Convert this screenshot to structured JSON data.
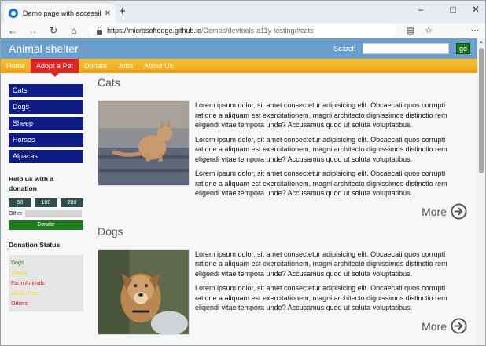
{
  "browser": {
    "tab_title": "Demo page with accessibility iss",
    "tab_close": "✕",
    "new_tab": "+",
    "url_host": "https://microsoftedge.github.io",
    "url_path": "/Demos/devtools-a11y-testing/#cats"
  },
  "site": {
    "title": "Animal shelter",
    "search_label": "Search",
    "search_value": "",
    "go_label": "go"
  },
  "topnav": [
    {
      "label": "Home"
    },
    {
      "label": "Adopt a Pet"
    },
    {
      "label": "Donate"
    },
    {
      "label": "Jobs"
    },
    {
      "label": "About Us"
    }
  ],
  "sidebar": {
    "items": [
      {
        "label": "Cats"
      },
      {
        "label": "Dogs"
      },
      {
        "label": "Sheep"
      },
      {
        "label": "Horses"
      },
      {
        "label": "Alpacas"
      }
    ],
    "help_title": "Help us with a donation",
    "amounts": [
      "50",
      "100",
      "200"
    ],
    "other_label": "Other",
    "donate_label": "Donate",
    "status_title": "Donation Status",
    "status": [
      {
        "label": "Dogs",
        "color": "#1f7a1f"
      },
      {
        "label": "Sheep",
        "color": "#f0e020"
      },
      {
        "label": "Farm Animals",
        "color": "#e02424"
      },
      {
        "label": "Exotic Pets",
        "color": "#f0e020"
      },
      {
        "label": "Others",
        "color": "#e02424"
      }
    ]
  },
  "sections": [
    {
      "title": "Cats",
      "paragraphs": [
        "Lorem ipsum dolor, sit amet consectetur adipisicing elit. Obcaecati quos corrupti ratione a aliquam est exercitationem, magni architecto dignissimos distinctio rem eligendi vitae tempora unde? Accusamus quod ut soluta voluptatibus.",
        "Lorem ipsum dolor, sit amet consectetur adipisicing elit. Obcaecati quos corrupti ratione a aliquam est exercitationem, magni architecto dignissimos distinctio rem eligendi vitae tempora unde? Accusamus quod ut soluta voluptatibus.",
        "Lorem ipsum dolor, sit amet consectetur adipisicing elit. Obcaecati quos corrupti ratione a aliquam est exercitationem, magni architecto dignissimos distinctio rem eligendi vitae tempora unde? Accusamus quod ut soluta voluptatibus."
      ],
      "more_label": "More"
    },
    {
      "title": "Dogs",
      "paragraphs": [
        "Lorem ipsum dolor, sit amet consectetur adipisicing elit. Obcaecati quos corrupti ratione a aliquam est exercitationem, magni architecto dignissimos distinctio rem eligendi vitae tempora unde? Accusamus quod ut soluta voluptatibus.",
        "Lorem ipsum dolor, sit amet consectetur adipisicing elit. Obcaecati quos corrupti ratione a aliquam est exercitationem, magni architecto dignissimos distinctio rem eligendi vitae tempora unde? Accusamus quod ut soluta voluptatibus."
      ],
      "more_label": "More"
    }
  ],
  "colors": {
    "header_blue": "#6b9fcd",
    "nav_orange": "#f2a516",
    "active_red": "#e02424",
    "sidebar_navy": "#0f1c85",
    "green": "#1f7a1f"
  }
}
